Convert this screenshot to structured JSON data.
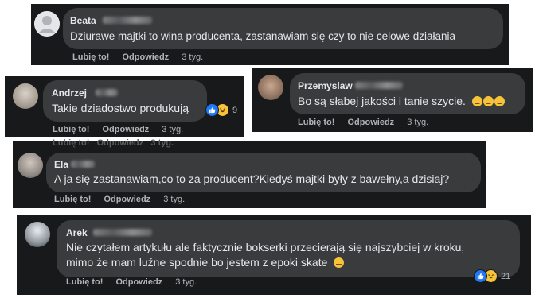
{
  "comments": [
    {
      "author": "Beata",
      "text": "Dziurawe majtki to wina producenta, zastanawiam się czy to nie celowe działania",
      "like": "Lubię to!",
      "reply": "Odpowiedz",
      "time": "3 tyg."
    },
    {
      "author": "Andrzej",
      "text": "Takie dziadostwo produkują",
      "reactions": "9",
      "like": "Lubię to!",
      "reply": "Odpowiedz",
      "time": "3 tyg."
    },
    {
      "author": "Przemyslaw",
      "text": "Bo są słabej jakości i tanie szycie.",
      "like": "Lubię to!",
      "reply": "Odpowiedz",
      "time": "3 tyg."
    },
    {
      "author": "Ela",
      "text": "A ja się zastanawiam,co to za producent?Kiedyś majtki były z bawełny,a dzisiaj?",
      "like": "Lubię to!",
      "reply": "Odpowiedz",
      "time": "3 tyg."
    },
    {
      "author": "Arek",
      "text_line1": "Nie czytałem artykułu ale faktycznie bokserki przecierają się najszybciej w kroku,",
      "text_line2": "mimo że mam luźne spodnie bo jestem z epoki skate",
      "reactions": "21",
      "like": "Lubię to!",
      "reply": "Odpowiedz",
      "time": "3 tyg."
    }
  ],
  "colors": {
    "card": "#18191a",
    "bubble": "#3a3b3c",
    "text": "#e4e6eb",
    "meta": "#b0b3b8",
    "like": "#2078f4",
    "haha": "#f7c338"
  },
  "icons": [
    "default-avatar-icon",
    "like-reaction-icon",
    "haha-reaction-icon",
    "smile-emoji-icon",
    "laugh-emoji-icon"
  ]
}
